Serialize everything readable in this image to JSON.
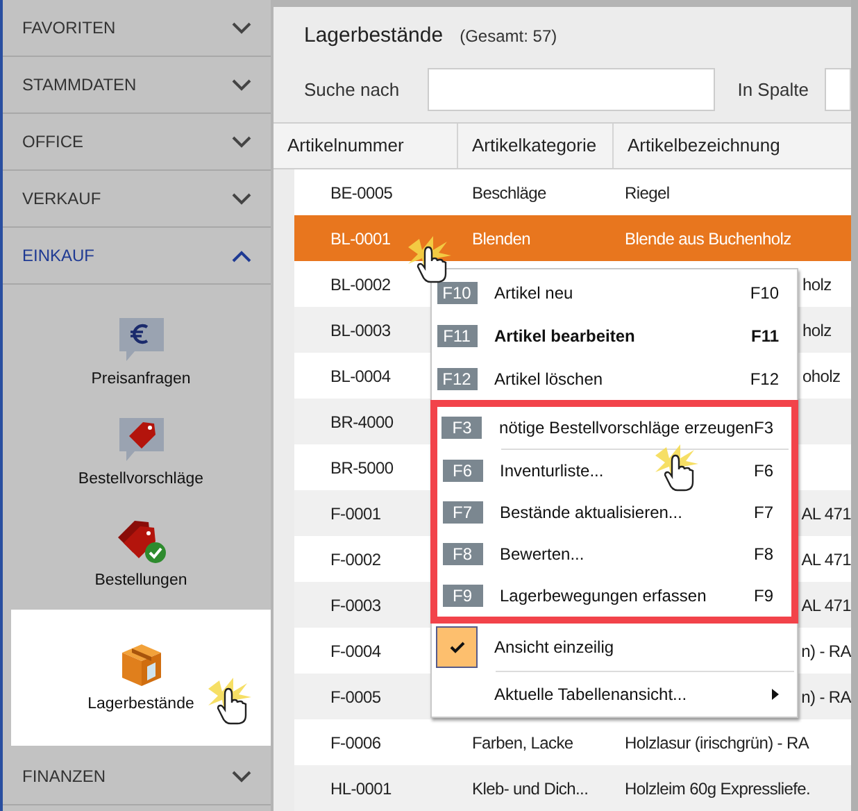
{
  "sidebar": {
    "sections": [
      {
        "label": "FAVORITEN",
        "expanded": false
      },
      {
        "label": "STAMMDATEN",
        "expanded": false
      },
      {
        "label": "OFFICE",
        "expanded": false
      },
      {
        "label": "VERKAUF",
        "expanded": false
      },
      {
        "label": "EINKAUF",
        "expanded": true,
        "items": [
          {
            "label": "Preisanfragen",
            "kind": "euro",
            "selected": false
          },
          {
            "label": "Bestellvorschläge",
            "kind": "tag",
            "selected": false
          },
          {
            "label": "Bestellungen",
            "kind": "tag-check",
            "selected": false
          },
          {
            "label": "Lagerbestände",
            "kind": "box",
            "selected": true
          }
        ]
      },
      {
        "label": "FINANZEN",
        "expanded": false
      }
    ]
  },
  "page": {
    "title": "Lagerbestände",
    "total": "(Gesamt: 57)",
    "search_label": "Suche nach",
    "column_label": "In Spalte"
  },
  "table": {
    "columns": [
      "Artikelnummer",
      "Artikelkategorie",
      "Artikelbezeichnung"
    ],
    "rows": [
      {
        "number": "BE-0005",
        "category": "Beschläge",
        "description": "Riegel",
        "selected": false
      },
      {
        "number": "BL-0001",
        "category": "Blenden",
        "description": "Blende aus Buchenholz",
        "selected": true
      },
      {
        "number": "BL-0002",
        "description_fragment": "holz",
        "selected": false
      },
      {
        "number": "BL-0003",
        "description_fragment": "holz",
        "selected": false
      },
      {
        "number": "BL-0004",
        "description_fragment": "oholz",
        "selected": false
      },
      {
        "number": "BR-4000",
        "selected": false
      },
      {
        "number": "BR-5000",
        "selected": false
      },
      {
        "number": "F-0001",
        "description_fragment": "AL 471",
        "selected": false
      },
      {
        "number": "F-0002",
        "description_fragment": "AL 471",
        "selected": false
      },
      {
        "number": "F-0003",
        "description_fragment": "AL 471",
        "selected": false
      },
      {
        "number": "F-0004",
        "description_fragment": "n) - RA",
        "selected": false
      },
      {
        "number": "F-0005",
        "description_fragment": "n) - RA",
        "selected": false
      },
      {
        "number": "F-0006",
        "category": "Farben, Lacke",
        "description": "Holzlasur (irischgrün) - RA",
        "selected": false
      },
      {
        "number": "HL-0001",
        "category": "Kleb- und Dich...",
        "description": "Holzleim 60g Expressliefe.",
        "selected": false
      }
    ]
  },
  "context_menu": {
    "sections": [
      {
        "highlighted": false,
        "items": [
          {
            "kind": "command",
            "key": "F10",
            "label": "Artikel neu",
            "shortcut": "F10",
            "bold": false
          },
          {
            "kind": "command",
            "key": "F11",
            "label": "Artikel bearbeiten",
            "shortcut": "F11",
            "bold": true
          },
          {
            "kind": "command",
            "key": "F12",
            "label": "Artikel löschen",
            "shortcut": "F12",
            "bold": false
          }
        ]
      },
      {
        "highlighted": true,
        "items": [
          {
            "kind": "command",
            "key": "F3",
            "label": "nötige Bestellvorschläge erzeugen",
            "shortcut": "F3",
            "bold": false,
            "separator_after": true
          },
          {
            "kind": "command",
            "key": "F6",
            "label": "Inventurliste...",
            "shortcut": "F6",
            "bold": false
          },
          {
            "kind": "command",
            "key": "F7",
            "label": "Bestände aktualisieren...",
            "shortcut": "F7",
            "bold": false
          },
          {
            "kind": "command",
            "key": "F8",
            "label": "Bewerten...",
            "shortcut": "F8",
            "bold": false
          },
          {
            "kind": "command",
            "key": "F9",
            "label": "Lagerbewegungen erfassen",
            "shortcut": "F9",
            "bold": false
          }
        ]
      },
      {
        "highlighted": false,
        "items": [
          {
            "kind": "check",
            "label": "Ansicht einzeilig",
            "checked": true,
            "separator_after": true
          },
          {
            "kind": "submenu",
            "label": "Aktuelle Tabellenansicht..."
          }
        ]
      }
    ]
  }
}
